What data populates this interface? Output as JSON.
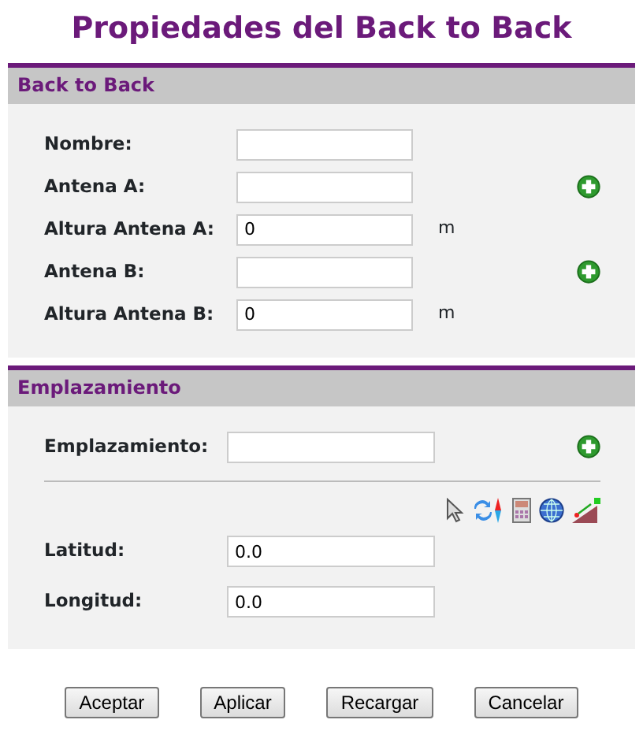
{
  "title": "Propiedades del Back to Back",
  "sections": [
    {
      "title": "Back to Back",
      "rows": [
        {
          "kind": "field",
          "label": "Nombre:",
          "value": "",
          "add": false
        },
        {
          "kind": "field",
          "label": "Antena A:",
          "value": "",
          "add": true
        },
        {
          "kind": "field",
          "label": "Altura Antena A:",
          "value": "0",
          "unit": "m",
          "add": false
        },
        {
          "kind": "field",
          "label": "Antena B:",
          "value": "",
          "add": true
        },
        {
          "kind": "field",
          "label": "Altura Antena B:",
          "value": "0",
          "unit": "m",
          "add": false
        }
      ]
    },
    {
      "title": "Emplazamiento",
      "rows": [
        {
          "kind": "field",
          "label": "Emplazamiento:",
          "value": "",
          "add": true
        },
        {
          "kind": "divider"
        },
        {
          "kind": "tools"
        },
        {
          "kind": "field",
          "label": "Latitud:",
          "value": "0.0",
          "add": false
        },
        {
          "kind": "field",
          "label": "Longitud:",
          "value": "0.0",
          "add": false
        }
      ]
    }
  ],
  "buttons": [
    "Aceptar",
    "Aplicar",
    "Recargar",
    "Cancelar"
  ]
}
